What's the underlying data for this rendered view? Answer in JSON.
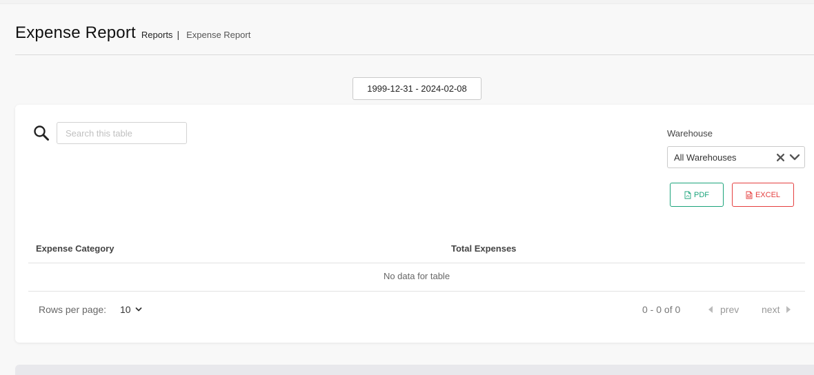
{
  "header": {
    "title": "Expense Report",
    "breadcrumb_parent": "Reports",
    "breadcrumb_separator": "|",
    "breadcrumb_current": "Expense Report"
  },
  "date_filter": {
    "value": "1999-12-31 - 2024-02-08"
  },
  "search": {
    "placeholder": "Search this table",
    "value": ""
  },
  "warehouse": {
    "label": "Warehouse",
    "selected": "All Warehouses",
    "clear_icon": "close-icon",
    "dropdown_icon": "chevron-down-icon"
  },
  "export": {
    "pdf_label": "PDF",
    "excel_label": "EXCEL",
    "pdf_color": "#1aa37a",
    "excel_color": "#e53e3e"
  },
  "table": {
    "columns": [
      "Expense Category",
      "Total Expenses"
    ],
    "rows": [],
    "empty_message": "No data for table"
  },
  "pagination": {
    "rows_per_page_label": "Rows per page:",
    "rows_per_page_value": "10",
    "range_text": "0 - 0 of 0",
    "prev_label": "prev",
    "next_label": "next"
  }
}
